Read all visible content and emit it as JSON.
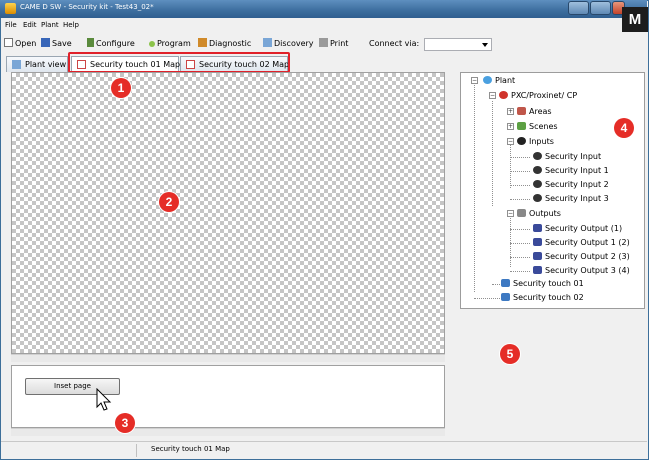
{
  "window": {
    "title": "CAME D SW - Security kit - Test43_02*"
  },
  "menu": [
    "File",
    "Edit",
    "Plant",
    "Help"
  ],
  "toolbar": {
    "open": "Open",
    "save": "Save",
    "configure": "Configure",
    "program": "Program",
    "diagnostic": "Diagnostic",
    "discovery": "Discovery",
    "print": "Print",
    "connect_label": "Connect via:",
    "connect_value": ""
  },
  "tabs": [
    {
      "label": "Plant view"
    },
    {
      "label": "Security touch 01 Map"
    },
    {
      "label": "Security touch 02 Map"
    }
  ],
  "inset_button": "Inset page",
  "status": "Security touch 01 Map",
  "corner_badge": "M",
  "callouts": [
    "1",
    "2",
    "3",
    "4",
    "5"
  ],
  "tree": {
    "root": "Plant",
    "cp": "PXC/Proxinet/ CP",
    "areas": "Areas",
    "scenes": "Scenes",
    "inputs": "Inputs",
    "input_items": [
      "Security Input",
      "Security Input 1",
      "Security Input 2",
      "Security Input 3"
    ],
    "outputs": "Outputs",
    "output_items": [
      "Security Output (1)",
      "Security Output 1 (2)",
      "Security Output 2 (3)",
      "Security Output 3 (4)"
    ],
    "touch1": "Security touch 01",
    "touch2": "Security touch 02"
  },
  "colors": {
    "callout": "#e52d27",
    "title_bar": "#3c6d9e",
    "highlight_box": "#e0212a"
  }
}
